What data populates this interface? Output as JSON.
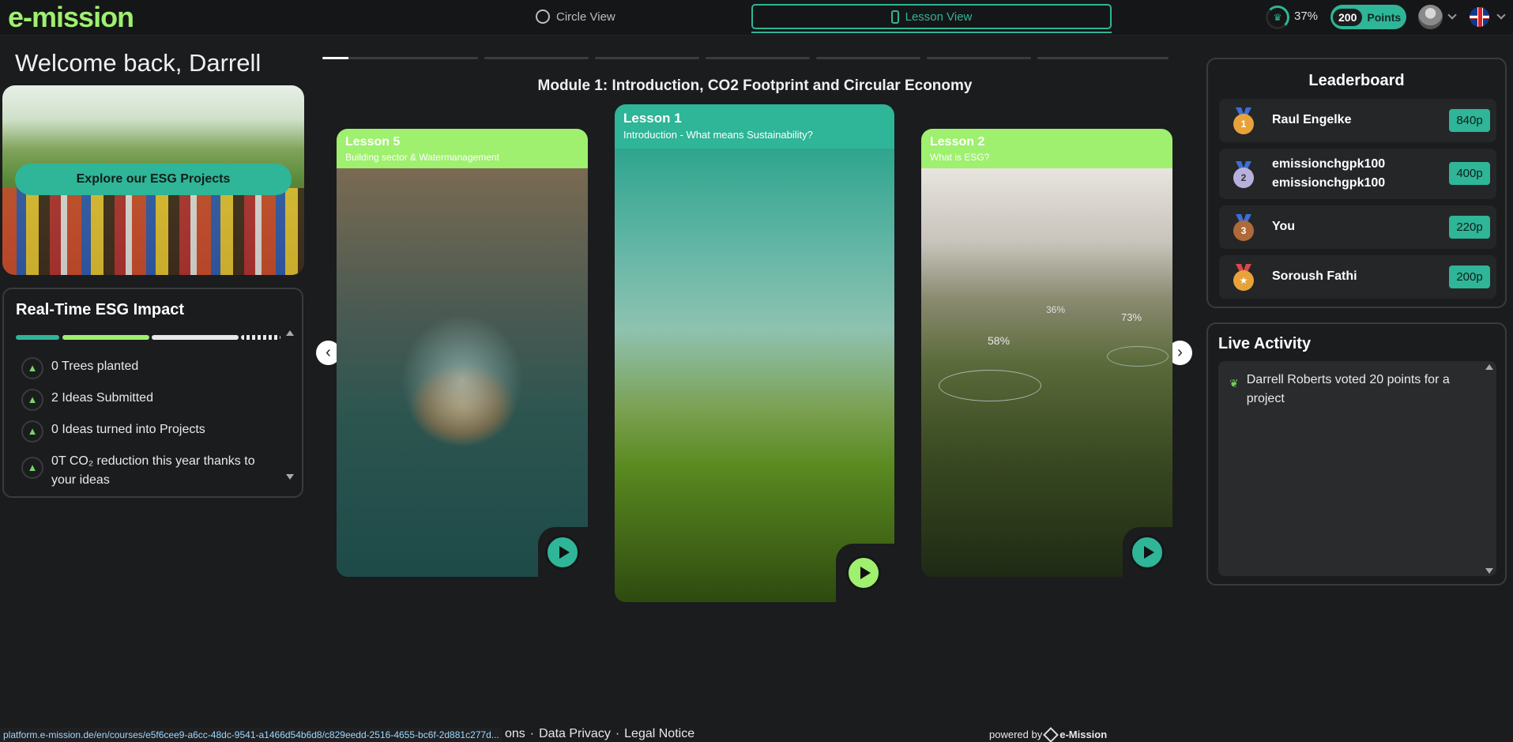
{
  "header": {
    "logo": "e-mission",
    "circle_view": "Circle View",
    "lesson_view": "Lesson View",
    "progress": "37%",
    "points_value": "200",
    "points_label": "Points"
  },
  "welcome": "Welcome back, Darrell",
  "esg_button": "Explore our ESG Projects",
  "impact": {
    "title": "Real-Time ESG Impact",
    "items": [
      "0 Trees planted",
      "2 Ideas Submitted",
      "0 Ideas turned into Projects",
      "0T CO₂ reduction this year thanks to your ideas"
    ]
  },
  "module": {
    "title": "Module 1: Introduction, CO2 Footprint and Circular Economy",
    "lessons": [
      {
        "title": "Lesson 5",
        "subtitle": "Building sector & Watermanagement"
      },
      {
        "title": "Lesson 1",
        "subtitle": "Introduction - What means Sustainability?"
      },
      {
        "title": "Lesson 2",
        "subtitle": "What is ESG?"
      }
    ],
    "overlay_labels": [
      "58%",
      "36%",
      "73%"
    ]
  },
  "leaderboard": {
    "title": "Leaderboard",
    "rows": [
      {
        "rank": "1",
        "name": "Raul Engelke",
        "points": "840p"
      },
      {
        "rank": "2",
        "name": "emissionchgpk100 emissionchgpk100",
        "points": "400p"
      },
      {
        "rank": "3",
        "name": "You",
        "points": "220p"
      },
      {
        "rank": "★",
        "name": "Soroush Fathi",
        "points": "200p"
      }
    ]
  },
  "live": {
    "title": "Live Activity",
    "items": [
      "Darrell Roberts voted 20 points for a project"
    ]
  },
  "footer": {
    "url": "platform.e-mission.de/en/courses/e5f6cee9-a6cc-48dc-9541-a1466d54b6d8/c829eedd-2516-4655-bc6f-2d881c277d...",
    "link_partial": "ons",
    "data_privacy": "Data Privacy",
    "legal_notice": "Legal Notice",
    "powered_by": "powered by",
    "brand": "e-Mission"
  },
  "colors": {
    "accent": "#2fb597",
    "lime": "#9ef06e",
    "bg": "#1b1c1e"
  }
}
